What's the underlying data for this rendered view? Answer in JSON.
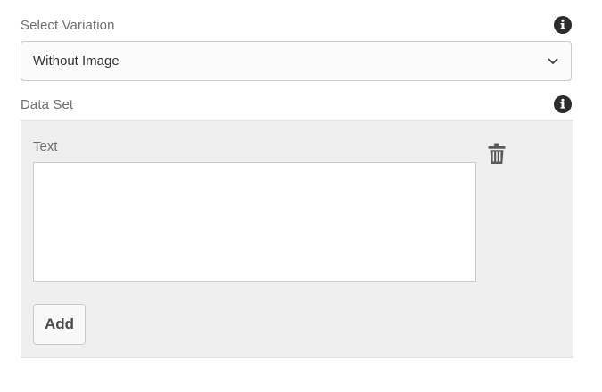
{
  "variation": {
    "label": "Select Variation",
    "selected": "Without Image",
    "info_icon": "info-icon",
    "chevron_icon": "chevron-down-icon"
  },
  "dataset": {
    "label": "Data Set",
    "info_icon": "info-icon",
    "item": {
      "text_label": "Text",
      "text_value": "",
      "delete_icon": "trash-icon"
    },
    "add_label": "Add"
  },
  "colors": {
    "panel_bg": "#efefef",
    "icon_dark": "#2c2c2c",
    "text": "#4b4b4b"
  }
}
